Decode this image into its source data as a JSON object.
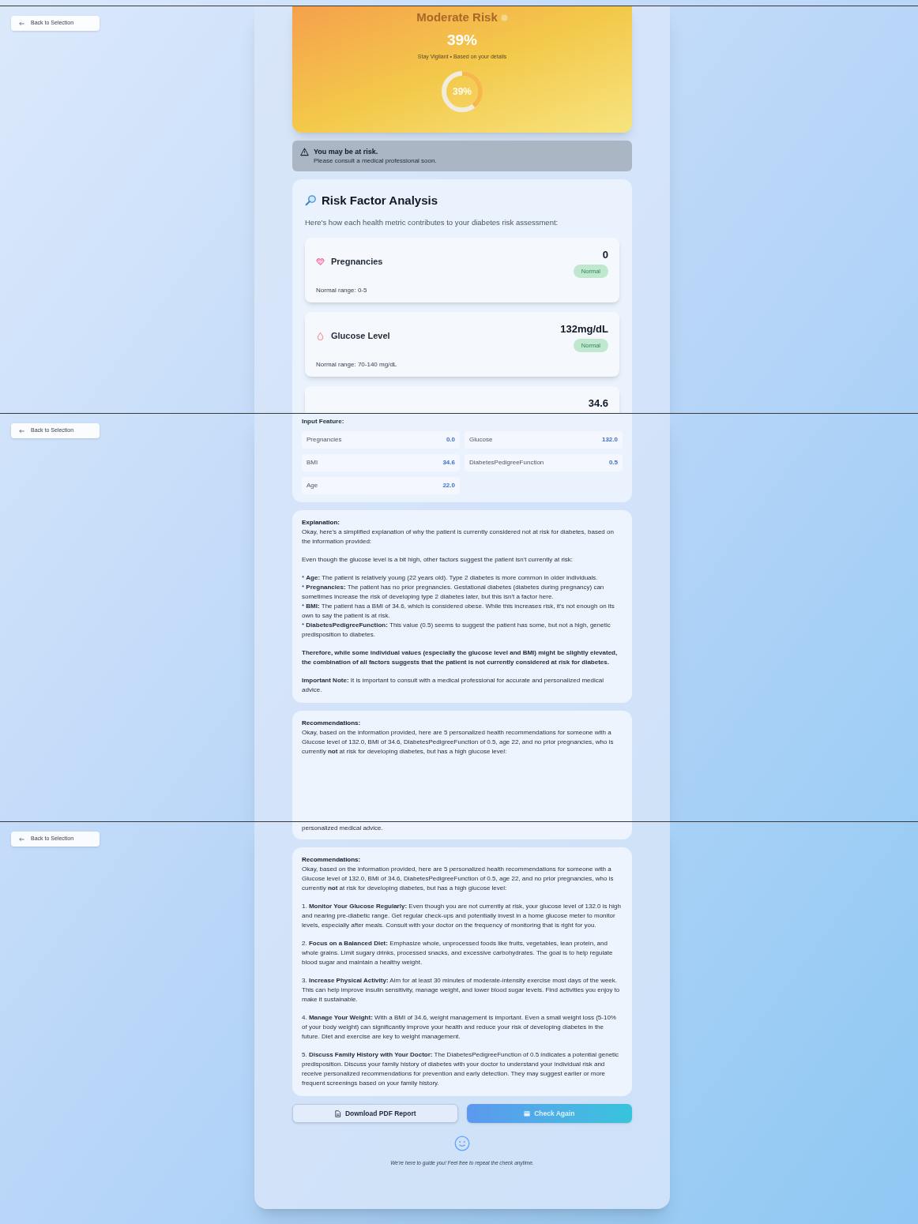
{
  "panels": [
    {
      "back_button": "Back to Selection",
      "blocks": [
        {
          "kind": "risk_card",
          "title": "Moderate Risk",
          "percent": "39%",
          "subtitle": "Stay Vigilant • Based on your details",
          "gauge_label": "39%"
        },
        {
          "kind": "alert",
          "title": "You may be at risk.",
          "message": "Please consult a medical professional soon."
        },
        {
          "kind": "analysis",
          "title": "Risk Factor Analysis",
          "intro": "Here's how each health metric contributes to your diabetes risk assessment:",
          "factors": [
            {
              "kind": "heart",
              "name": "Pregnancies",
              "value": "0",
              "badge": "Normal",
              "range": "Normal range: 0-5"
            },
            {
              "kind": "drop",
              "name": "Glucose Level",
              "value": "132mg/dL",
              "badge": "Normal",
              "range": "Normal range: 70-140 mg/dL"
            },
            {
              "kind": "cut",
              "value": "34.6"
            }
          ]
        }
      ]
    },
    {
      "back_button": "Back to Selection",
      "blocks": [
        {
          "kind": "features",
          "title": "Input Feature:",
          "items": [
            {
              "label": "Pregnancies",
              "value": "0.0"
            },
            {
              "label": "Glucose",
              "value": "132.0"
            },
            {
              "label": "BMI",
              "value": "34.6"
            },
            {
              "label": "DiabetesPedigreeFunction",
              "value": "0.5"
            },
            {
              "label": "Age",
              "value": "22.0"
            }
          ]
        },
        {
          "kind": "text",
          "title": "Explanation:",
          "paragraphs": [
            {
              "lines": [
                "Okay, here's a simplified explanation of why the patient is currently considered not at risk for diabetes, based on the information provided:"
              ]
            },
            {
              "lines": [
                "Even though the glucose level is a bit high, other factors suggest the patient isn't currently at risk:"
              ]
            },
            {
              "lines": [
                "* **Age:** The patient is relatively young (22 years old). Type 2 diabetes is more common in older individuals.",
                "* **Pregnancies:** The patient has no prior pregnancies. Gestational diabetes (diabetes during pregnancy) can sometimes increase the risk of developing type 2 diabetes later, but this isn't a factor here.",
                "* **BMI:** The patient has a BMI of 34.6, which is considered obese. While this increases risk, it's not enough on its own to say the patient is at risk.",
                "* **DiabetesPedigreeFunction:** This value (0.5) seems to suggest the patient has some, but not a high, genetic predisposition to diabetes."
              ]
            },
            {
              "lines": [
                "Therefore, while some individual values (especially the glucose level and BMI) might be slightly elevated, the combination of all factors suggests that the patient is not currently considered at risk for diabetes."
              ],
              "bold": true
            },
            {
              "lines": [
                "**Important Note:** It is important to consult with a medical professional for accurate and personalized medical advice."
              ]
            }
          ]
        },
        {
          "kind": "text",
          "title": "Recommendations:",
          "paragraphs": [
            {
              "lines": [
                "Okay, based on the information provided, here are 5 personalized health recommendations for someone with a Glucose level of 132.0, BMI of 34.6, DiabetesPedigreeFunction of 0.5, age 22, and no prior pregnancies, who is currently **not** at risk for developing diabetes, but has a high glucose level:"
              ]
            }
          ]
        }
      ]
    },
    {
      "back_button": "Back to Selection",
      "blocks": [
        {
          "kind": "text",
          "paragraphs": [
            {
              "lines": [
                "personalized medical advice."
              ]
            }
          ]
        },
        {
          "kind": "text",
          "title": "Recommendations:",
          "paragraphs": [
            {
              "lines": [
                "Okay, based on the information provided, here are 5 personalized health recommendations for someone with a Glucose level of 132.0, BMI of 34.6, DiabetesPedigreeFunction of 0.5, age 22, and no prior pregnancies, who is currently **not** at risk for developing diabetes, but has a high glucose level:"
              ]
            },
            {
              "lines": [
                "1. **Monitor Your Glucose Regularly:** Even though you are not currently at risk, your glucose level of 132.0 is high and nearing pre-diabetic range. Get regular check-ups and potentially invest in a home glucose meter to monitor levels, especially after meals. Consult with your doctor on the frequency of monitoring that is right for you."
              ]
            },
            {
              "lines": [
                "2. **Focus on a Balanced Diet:** Emphasize whole, unprocessed foods like fruits, vegetables, lean protein, and whole grains. Limit sugary drinks, processed snacks, and excessive carbohydrates. The goal is to help regulate blood sugar and maintain a healthy weight."
              ]
            },
            {
              "lines": [
                "3. **Increase Physical Activity:** Aim for at least 30 minutes of moderate-intensity exercise most days of the week. This can help improve insulin sensitivity, manage weight, and lower blood sugar levels. Find activities you enjoy to make it sustainable."
              ]
            },
            {
              "lines": [
                "4. **Manage Your Weight:** With a BMI of 34.6, weight management is important. Even a small weight loss (5-10% of your body weight) can significantly improve your health and reduce your risk of developing diabetes in the future. Diet and exercise are key to weight management."
              ]
            },
            {
              "lines": [
                "5. **Discuss Family History with Your Doctor:** The DiabetesPedigreeFunction of 0.5 indicates a potential genetic predisposition. Discuss your family history of diabetes with your doctor to understand your individual risk and receive personalized recommendations for prevention and early detection. They may suggest earlier or more frequent screenings based on your family history."
              ]
            }
          ]
        },
        {
          "kind": "actions",
          "buttons": [
            {
              "kind": "download",
              "label": "Download PDF Report"
            },
            {
              "kind": "check",
              "label": "Check Again"
            }
          ]
        },
        {
          "kind": "footer",
          "text": "We're here to guide you! Feel free to repeat the check anytime."
        }
      ]
    }
  ]
}
